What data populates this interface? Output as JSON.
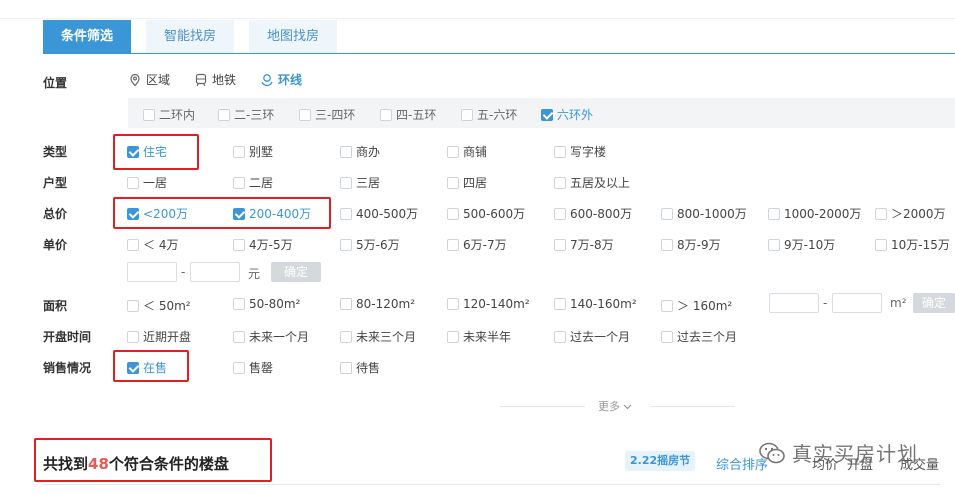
{
  "tabs": [
    {
      "label": "条件筛选",
      "active": true
    },
    {
      "label": "智能找房",
      "active": false
    },
    {
      "label": "地图找房",
      "active": false
    }
  ],
  "location": {
    "label": "位置",
    "modes": [
      {
        "label": "区域",
        "icon": "location-pin-icon",
        "selected": false
      },
      {
        "label": "地铁",
        "icon": "subway-icon",
        "selected": false
      },
      {
        "label": "环线",
        "icon": "ring-road-icon",
        "selected": true
      }
    ],
    "rings": [
      {
        "label": "二环内",
        "checked": false
      },
      {
        "label": "二-三环",
        "checked": false
      },
      {
        "label": "三-四环",
        "checked": false
      },
      {
        "label": "四-五环",
        "checked": false
      },
      {
        "label": "五-六环",
        "checked": false
      },
      {
        "label": "六环外",
        "checked": true
      }
    ]
  },
  "type": {
    "label": "类型",
    "options": [
      {
        "label": "住宅",
        "checked": true
      },
      {
        "label": "别墅",
        "checked": false
      },
      {
        "label": "商办",
        "checked": false
      },
      {
        "label": "商铺",
        "checked": false
      },
      {
        "label": "写字楼",
        "checked": false
      }
    ]
  },
  "layout": {
    "label": "户型",
    "options": [
      {
        "label": "一居",
        "checked": false
      },
      {
        "label": "二居",
        "checked": false
      },
      {
        "label": "三居",
        "checked": false
      },
      {
        "label": "四居",
        "checked": false
      },
      {
        "label": "五居及以上",
        "checked": false
      }
    ]
  },
  "total_price": {
    "label": "总价",
    "options": [
      {
        "label": "<200万",
        "checked": true
      },
      {
        "label": "200-400万",
        "checked": true
      },
      {
        "label": "400-500万",
        "checked": false
      },
      {
        "label": "500-600万",
        "checked": false
      },
      {
        "label": "600-800万",
        "checked": false
      },
      {
        "label": "800-1000万",
        "checked": false
      },
      {
        "label": "1000-2000万",
        "checked": false
      },
      {
        "label": "＞2000万",
        "checked": false
      }
    ]
  },
  "unit_price": {
    "label": "单价",
    "options": [
      {
        "label": "＜ 4万",
        "checked": false
      },
      {
        "label": "4万-5万",
        "checked": false
      },
      {
        "label": "5万-6万",
        "checked": false
      },
      {
        "label": "6万-7万",
        "checked": false
      },
      {
        "label": "7万-8万",
        "checked": false
      },
      {
        "label": "8万-9万",
        "checked": false
      },
      {
        "label": "9万-10万",
        "checked": false
      },
      {
        "label": "10万-15万",
        "checked": false
      }
    ],
    "range_dash": "-",
    "unit": "元",
    "confirm": "确定"
  },
  "area": {
    "label": "面积",
    "options": [
      {
        "label": "＜ 50m²",
        "checked": false
      },
      {
        "label": "50-80m²",
        "checked": false
      },
      {
        "label": "80-120m²",
        "checked": false
      },
      {
        "label": "120-140m²",
        "checked": false
      },
      {
        "label": "140-160m²",
        "checked": false
      },
      {
        "label": "＞ 160m²",
        "checked": false
      }
    ],
    "range_dash": "-",
    "unit": "m²",
    "confirm": "确定"
  },
  "opening": {
    "label": "开盘时间",
    "options": [
      {
        "label": "近期开盘",
        "checked": false
      },
      {
        "label": "未来一个月",
        "checked": false
      },
      {
        "label": "未来三个月",
        "checked": false
      },
      {
        "label": "未来半年",
        "checked": false
      },
      {
        "label": "过去一个月",
        "checked": false
      },
      {
        "label": "过去三个月",
        "checked": false
      }
    ]
  },
  "sales": {
    "label": "销售情况",
    "options": [
      {
        "label": "在售",
        "checked": true
      },
      {
        "label": "售罄",
        "checked": false
      },
      {
        "label": "待售",
        "checked": false
      }
    ]
  },
  "more": {
    "label": "更多"
  },
  "result": {
    "prefix": "共找到",
    "count": "48",
    "suffix": "个符合条件的楼盘"
  },
  "promo_badge": "2.22摇房节",
  "sort_options": [
    {
      "label": "综合排序",
      "active": true
    },
    {
      "label": "均价",
      "active": false
    },
    {
      "label": "开盘",
      "active": false
    },
    {
      "label": "成交量",
      "active": false
    }
  ],
  "watermark": {
    "text": "真实买房计划",
    "icon": "wechat-icon"
  },
  "colors": {
    "accent": "#3a96d6",
    "highlight_box": "#e02020",
    "count": "#e85a55"
  }
}
